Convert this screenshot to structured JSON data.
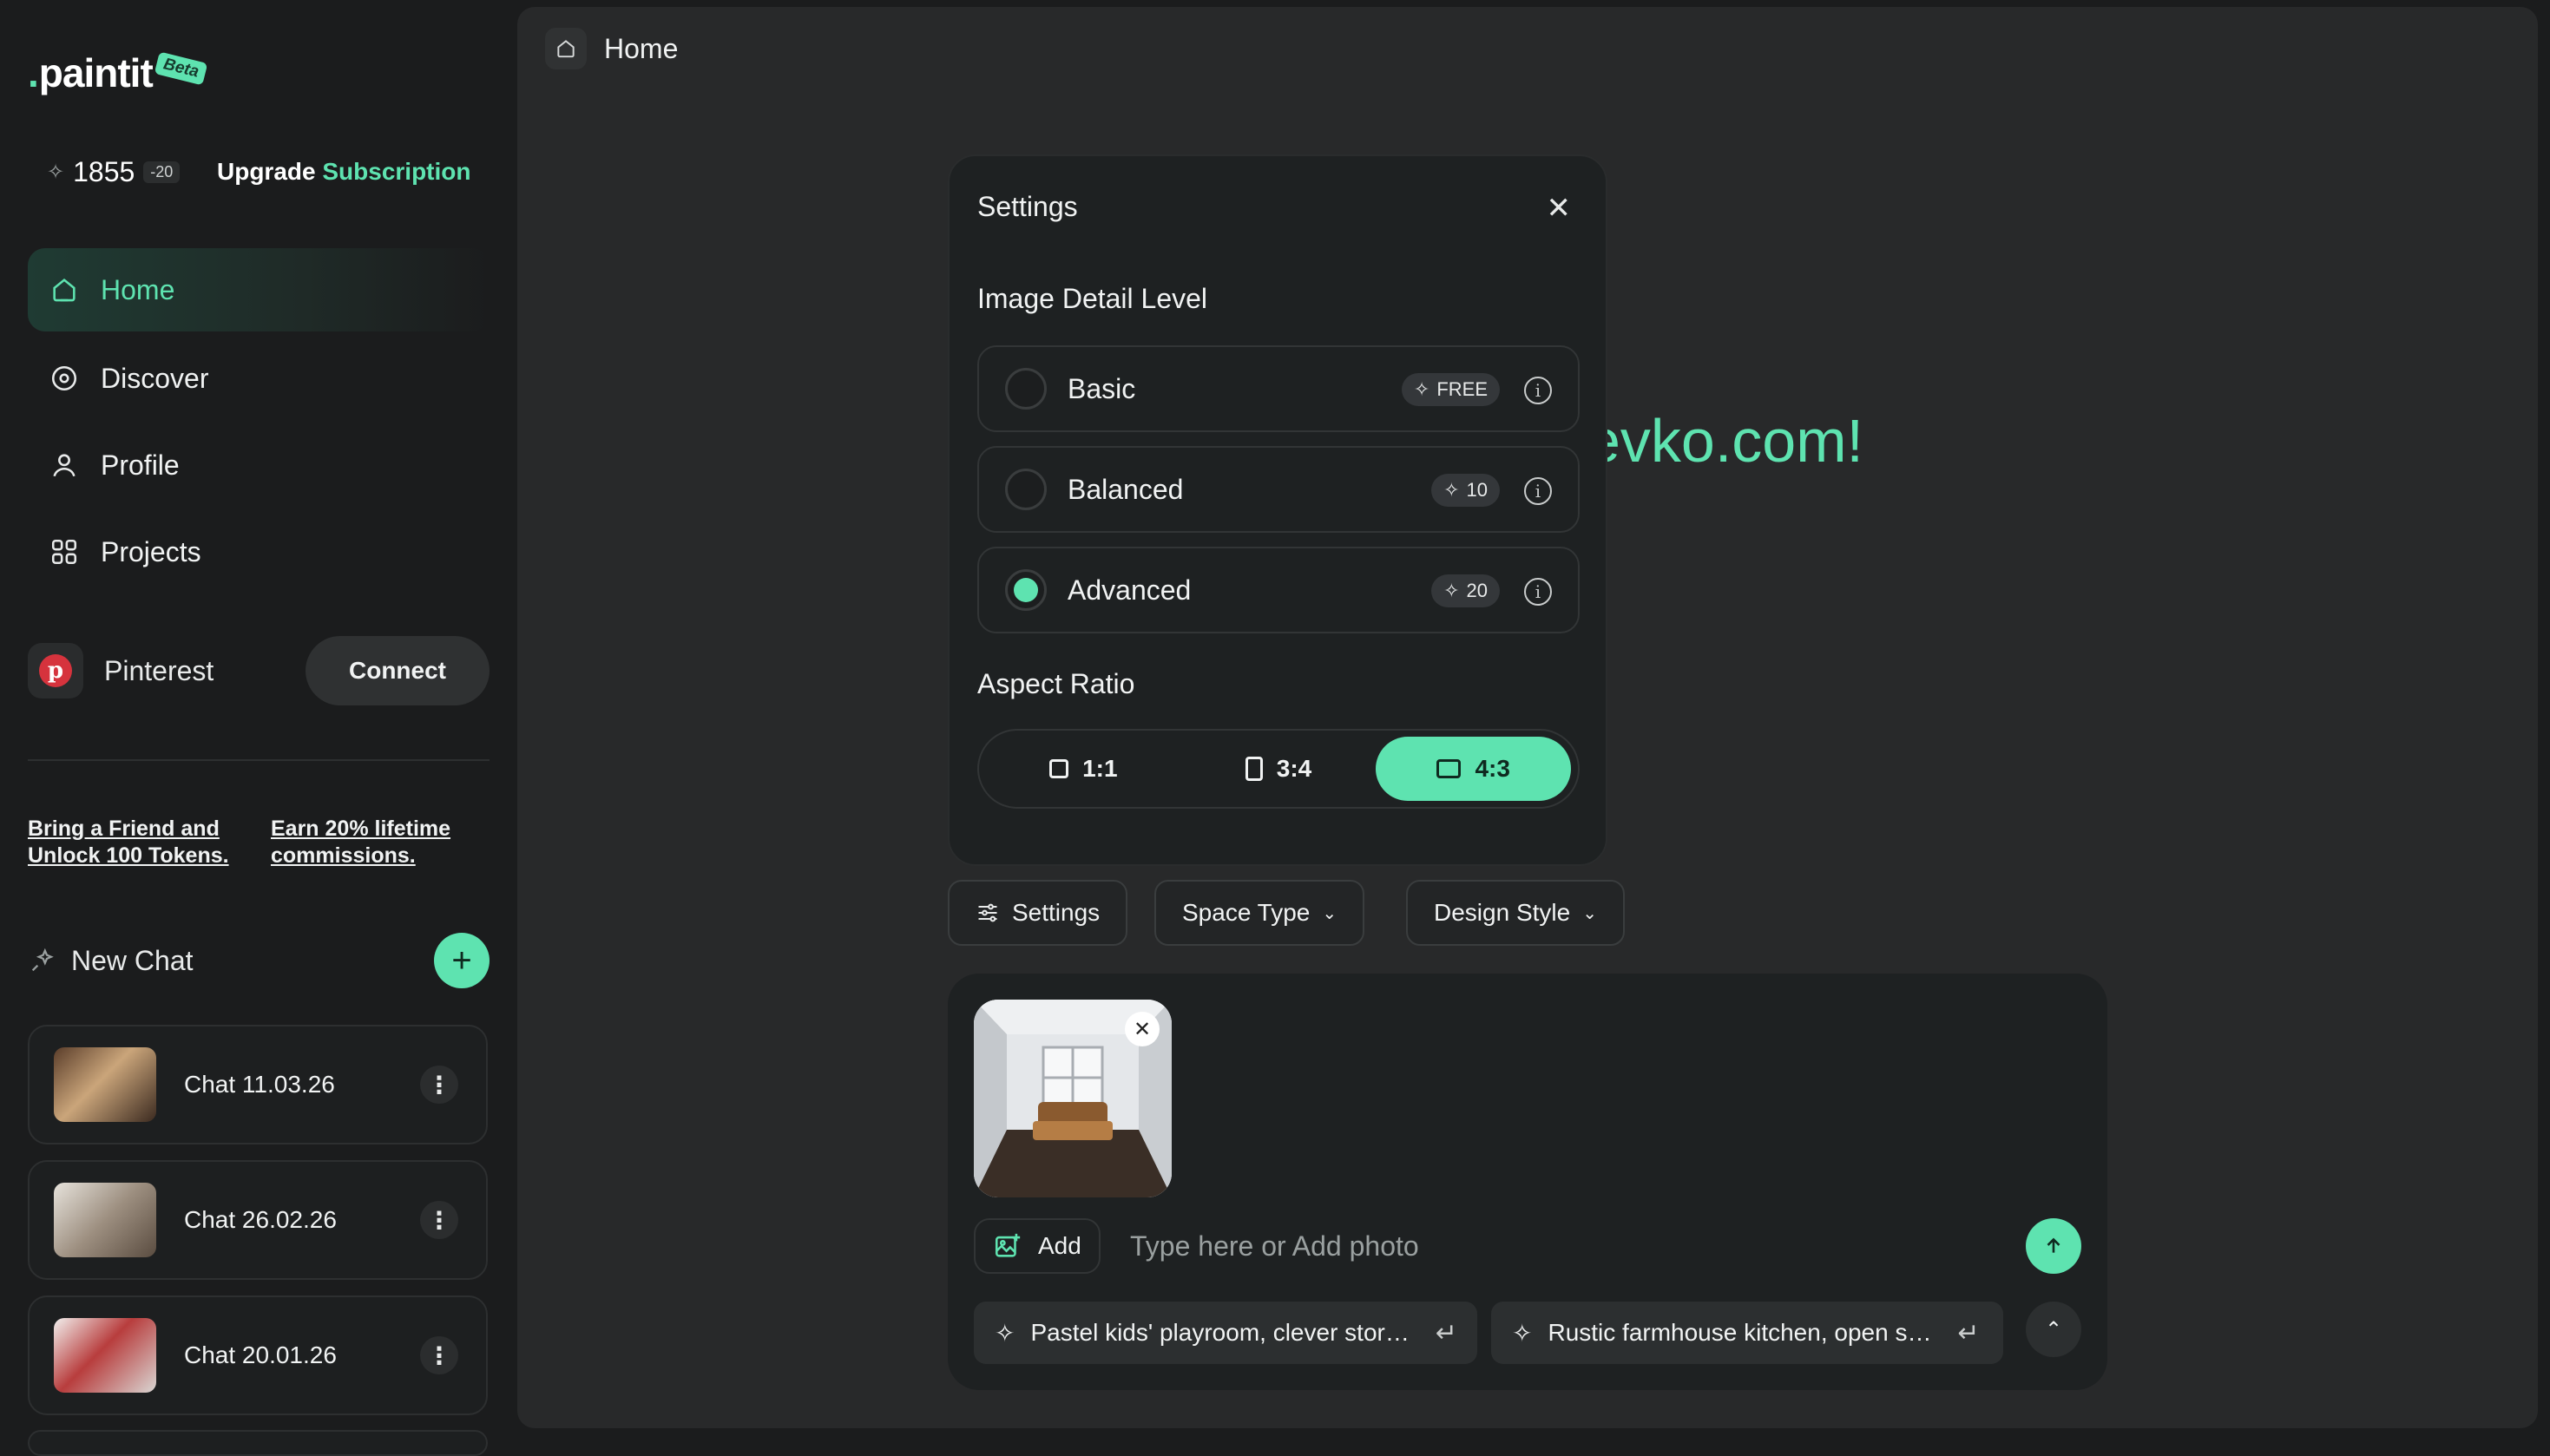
{
  "brand": {
    "dot": ".",
    "name": "paintit",
    "badge": "Beta"
  },
  "tokens": {
    "count": "1855",
    "delta": "-20",
    "upgrade_prefix": "Upgrade ",
    "upgrade_accent": "Subscription"
  },
  "nav": [
    {
      "label": "Home",
      "icon": "home-icon",
      "active": true
    },
    {
      "label": "Discover",
      "icon": "compass-icon",
      "active": false
    },
    {
      "label": "Profile",
      "icon": "user-icon",
      "active": false
    },
    {
      "label": "Projects",
      "icon": "grid-icon",
      "active": false
    }
  ],
  "pinterest": {
    "label": "Pinterest",
    "connect": "Connect"
  },
  "promos": {
    "friend": [
      "Bring a Friend and",
      "Unlock 100 Tokens."
    ],
    "commission": [
      "Earn 20% lifetime",
      "commissions."
    ]
  },
  "new_chat": {
    "label": "New Chat"
  },
  "chats": [
    {
      "label": "Chat 11.03.26"
    },
    {
      "label": "Chat 26.02.26"
    },
    {
      "label": "Chat 20.01.26"
    }
  ],
  "breadcrumb": {
    "label": "Home"
  },
  "welcome_fragment": "evko.com!",
  "settings": {
    "title": "Settings",
    "detail_heading": "Image Detail Level",
    "options": [
      {
        "label": "Basic",
        "cost": "FREE",
        "selected": false
      },
      {
        "label": "Balanced",
        "cost": "10",
        "selected": false
      },
      {
        "label": "Advanced",
        "cost": "20",
        "selected": true
      }
    ],
    "ratio_heading": "Aspect Ratio",
    "ratios": [
      {
        "label": "1:1",
        "selected": false
      },
      {
        "label": "3:4",
        "selected": false
      },
      {
        "label": "4:3",
        "selected": true
      }
    ]
  },
  "toolbar": {
    "settings": "Settings",
    "space_type": "Space Type",
    "design_style": "Design Style"
  },
  "composer": {
    "add_label": "Add",
    "placeholder": "Type here or Add photo",
    "suggestions": [
      "Pastel kids' playroom, clever stor…",
      "Rustic farmhouse kitchen, open s…"
    ]
  },
  "colors": {
    "accent": "#5ee3b0",
    "background": "#1b1c1d",
    "panel": "#28292a",
    "card": "#1e2122"
  }
}
